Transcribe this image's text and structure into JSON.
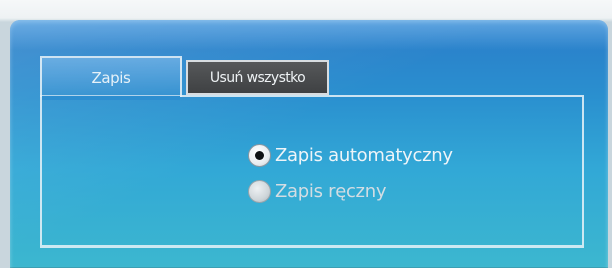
{
  "tabs": {
    "zapis_label": "Zapis",
    "usun_label": "Usuń wszystko"
  },
  "save_options": {
    "automatic_label": "Zapis automatyczny",
    "manual_label": "Zapis ręczny",
    "selected": "automatic"
  },
  "colors": {
    "panel_top": "#2b7cc9",
    "panel_bottom": "#3cb7cf",
    "inactive_tab": "#4a4c4e"
  },
  "icons": {
    "automatic_radio": "radio-selected-icon",
    "manual_radio": "radio-unselected-icon"
  }
}
